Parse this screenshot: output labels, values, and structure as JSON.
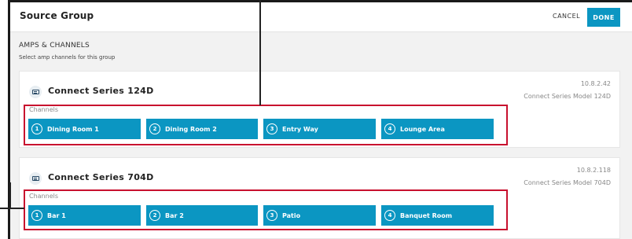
{
  "header": {
    "title": "Source Group",
    "cancel_label": "CANCEL",
    "done_label": "DONE"
  },
  "section": {
    "title": "AMPS & CHANNELS",
    "subtitle": "Select amp channels for this group"
  },
  "amps": [
    {
      "name": "Connect Series 124D",
      "ip": "10.8.2.42",
      "model": "Connect Series Model 124D",
      "channels_label": "Channels",
      "channels": [
        {
          "num": "1",
          "label": "Dining Room 1"
        },
        {
          "num": "2",
          "label": "Dining Room 2"
        },
        {
          "num": "3",
          "label": "Entry Way"
        },
        {
          "num": "4",
          "label": "Lounge Area"
        }
      ]
    },
    {
      "name": "Connect Series 704D",
      "ip": "10.8.2.118",
      "model": "Connect Series Model 704D",
      "channels_label": "Channels",
      "channels": [
        {
          "num": "1",
          "label": "Bar 1"
        },
        {
          "num": "2",
          "label": "Bar 2"
        },
        {
          "num": "3",
          "label": "Patio"
        },
        {
          "num": "4",
          "label": "Banquet Room"
        }
      ]
    }
  ],
  "colors": {
    "accent": "#0b96c2",
    "highlight": "#c8102e"
  }
}
